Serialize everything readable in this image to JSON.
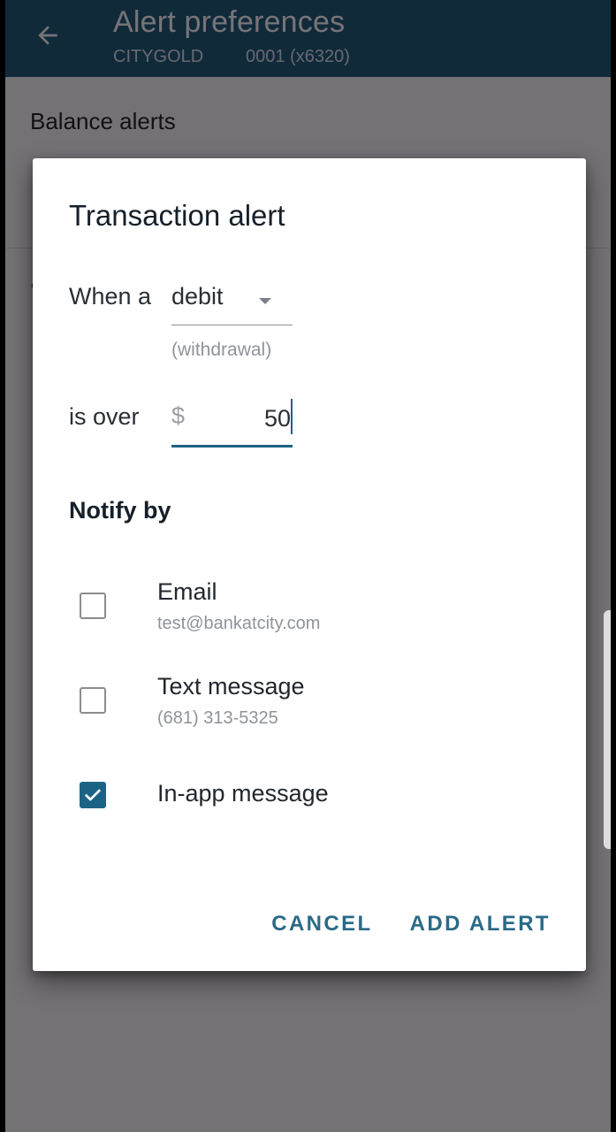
{
  "appbar": {
    "title": "Alert preferences",
    "card_name": "CITYGOLD",
    "account": "0001 (x6320)",
    "back_icon": "arrow-left-icon",
    "color": "#0b4f6c"
  },
  "background": {
    "section_title": "Balance alerts"
  },
  "dialog": {
    "title": "Transaction alert",
    "when_label": "When a",
    "transaction_type": {
      "selected": "debit",
      "helper": "(withdrawal)",
      "icon": "dropdown-arrow-icon"
    },
    "over_label": "is over",
    "amount": {
      "prefix": "$",
      "value": "50"
    },
    "notify_title": "Notify by",
    "options": [
      {
        "label": "Email",
        "detail": "test@bankatcity.com",
        "checked": false
      },
      {
        "label": "Text message",
        "detail": "(681) 313-5325",
        "checked": false
      },
      {
        "label": "In-app message",
        "detail": "",
        "checked": true
      }
    ],
    "actions": {
      "cancel": "CANCEL",
      "confirm": "ADD ALERT"
    },
    "accent_color": "#1b6384"
  }
}
